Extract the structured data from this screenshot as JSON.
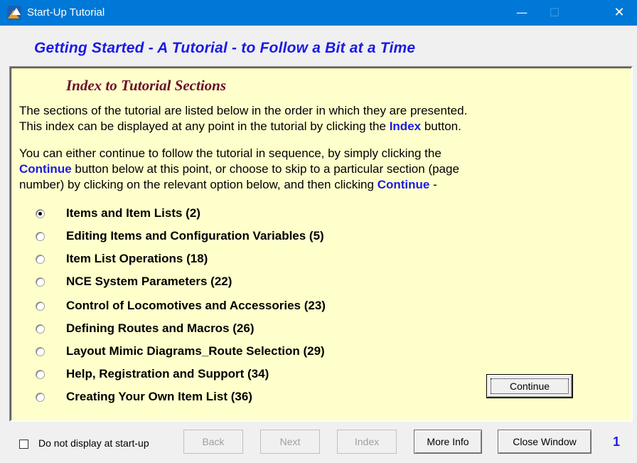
{
  "window": {
    "title": "Start-Up Tutorial",
    "controls": {
      "minimize": "—",
      "maximize": "☐",
      "close": "✕"
    }
  },
  "header": {
    "heading": "Getting Started  -  A Tutorial  -  to Follow a Bit at a Time"
  },
  "panel": {
    "section_title": "Index to Tutorial Sections",
    "para1": {
      "line1": "The sections of the tutorial are listed below in the order in which they are presented.",
      "line2_before": "This index can be displayed at any point in the tutorial by clicking the ",
      "line2_bold": "Index",
      "line2_after": " button."
    },
    "para2": {
      "line1": "You can either continue to follow the tutorial in sequence, by simply clicking the",
      "line2_bold": "Continue",
      "line2_after": " button below at this point, or choose to skip to a particular section (page",
      "line3_before": "number) by clicking on the relevant option below, and then clicking ",
      "line3_bold": "Continue",
      "line3_after": " -"
    },
    "options": [
      {
        "label": "Items and Item Lists  (2)",
        "checked": true
      },
      {
        "label": "Editing Items and Configuration Variables  (5)",
        "checked": false
      },
      {
        "label": "Item List Operations  (18)",
        "checked": false
      },
      {
        "label": "NCE System Parameters  (22)",
        "checked": false
      },
      {
        "label": "Control of Locomotives and Accessories  (23)",
        "checked": false
      },
      {
        "label": "Defining Routes and Macros  (26)",
        "checked": false
      },
      {
        "label": "Layout Mimic Diagrams_Route Selection  (29)",
        "checked": false
      },
      {
        "label": "Help, Registration and Support  (34)",
        "checked": false
      },
      {
        "label": "Creating Your Own Item List  (36)",
        "checked": false
      }
    ],
    "continue_label": "Continue"
  },
  "footer": {
    "checkbox_label": "Do not display at start-up",
    "checkbox_checked": false,
    "back_label": "Back",
    "next_label": "Next",
    "index_label": "Index",
    "more_info_label": "More Info",
    "close_window_label": "Close Window",
    "page_number": "1"
  },
  "colors": {
    "titlebar": "#0078d7",
    "heading": "#1a1ae6",
    "section_title": "#6b0f2a",
    "panel_bg": "#ffffcc",
    "window_bg": "#f0f0f0"
  }
}
